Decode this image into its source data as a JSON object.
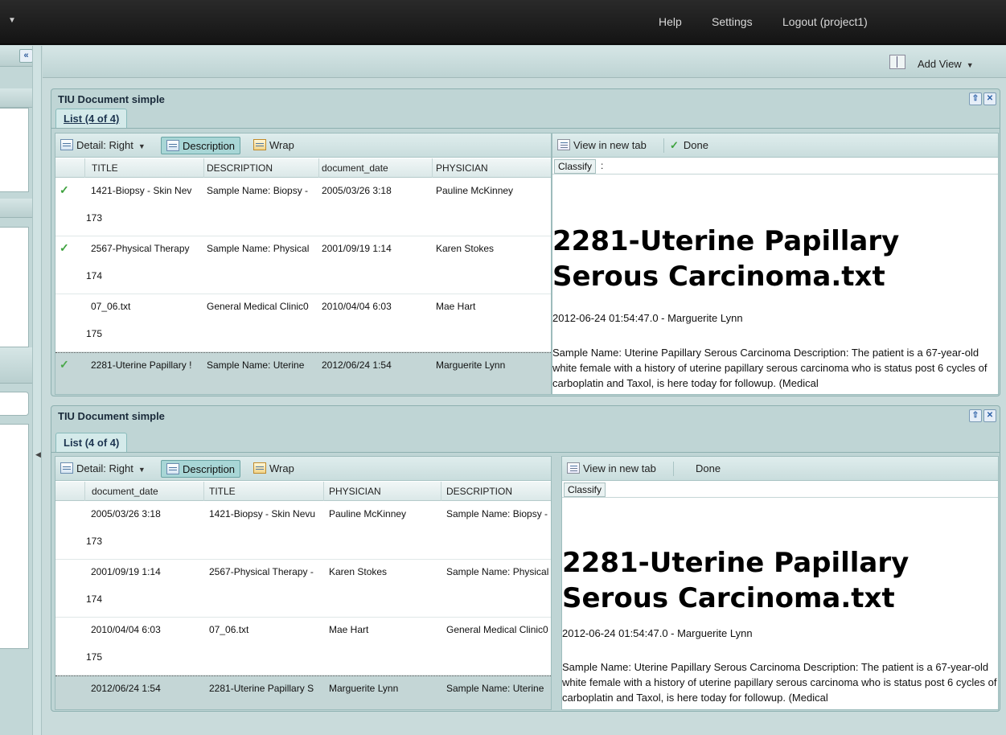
{
  "topbar": {
    "help": "Help",
    "settings": "Settings",
    "logout": "Logout (project1)"
  },
  "viewbar": {
    "add_view": "Add View"
  },
  "panels": [
    {
      "title": "TIU Document simple",
      "tab": "List (4 of 4)",
      "toolbar": {
        "detail": "Detail: Right",
        "description": "Description",
        "wrap": "Wrap"
      },
      "columns": [
        "TITLE",
        "DESCRIPTION",
        "document_date",
        "PHYSICIAN"
      ],
      "rows": [
        {
          "checked": true,
          "cells": [
            "1421-Biopsy - Skin Nev",
            "Sample Name: Biopsy -",
            "2005/03/26 3:18",
            "Pauline McKinney"
          ],
          "id": "173"
        },
        {
          "checked": true,
          "cells": [
            "2567-Physical Therapy",
            "Sample Name: Physical",
            "2001/09/19 1:14",
            "Karen Stokes"
          ],
          "id": "174"
        },
        {
          "checked": false,
          "cells": [
            "07_06.txt",
            "General Medical Clinic0",
            "2010/04/04 6:03",
            "Mae Hart"
          ],
          "id": "175"
        },
        {
          "checked": true,
          "cells": [
            "2281-Uterine Papillary !",
            "Sample Name: Uterine",
            "2012/06/24 1:54",
            "Marguerite Lynn"
          ],
          "id": ""
        }
      ],
      "detail": {
        "view_new_tab": "View in new tab",
        "done": "Done",
        "classify": "Classify",
        "classify_value": ":",
        "doc_title": "2281-Uterine Papillary Serous Carcinoma.txt",
        "meta": "2012-06-24 01:54:47.0 - Marguerite Lynn",
        "body": "Sample Name: Uterine Papillary Serous Carcinoma Description: The patient is a 67-year-old white female with a history of uterine papillary serous carcinoma who is status post 6 cycles of carboplatin and Taxol, is here today for followup. (Medical"
      }
    },
    {
      "title": "TIU Document simple",
      "tab": "List (4 of 4)",
      "toolbar": {
        "detail": "Detail: Right",
        "description": "Description",
        "wrap": "Wrap"
      },
      "columns": [
        "document_date",
        "TITLE",
        "PHYSICIAN",
        "DESCRIPTION"
      ],
      "rows": [
        {
          "checked": false,
          "cells": [
            "2005/03/26 3:18",
            "1421-Biopsy - Skin Nevu",
            "Pauline McKinney",
            "Sample Name: Biopsy -"
          ],
          "id": "173"
        },
        {
          "checked": false,
          "cells": [
            "2001/09/19 1:14",
            "2567-Physical Therapy -",
            "Karen Stokes",
            "Sample Name: Physical"
          ],
          "id": "174"
        },
        {
          "checked": false,
          "cells": [
            "2010/04/04 6:03",
            "07_06.txt",
            "Mae Hart",
            "General Medical Clinic0"
          ],
          "id": "175"
        },
        {
          "checked": false,
          "cells": [
            "2012/06/24 1:54",
            "2281-Uterine Papillary S",
            "Marguerite Lynn",
            "Sample Name: Uterine"
          ],
          "id": ""
        }
      ],
      "detail": {
        "view_new_tab": "View in new tab",
        "done": "Done",
        "classify": "Classify",
        "classify_value": "",
        "doc_title": "2281-Uterine Papillary Serous Carcinoma.txt",
        "meta": "2012-06-24 01:54:47.0 - Marguerite Lynn",
        "body": "Sample Name: Uterine Papillary Serous Carcinoma Description: The patient is a 67-year-old white female with a history of uterine papillary serous carcinoma who is status post 6 cycles of carboplatin and Taxol, is here today for followup. (Medical"
      }
    }
  ]
}
